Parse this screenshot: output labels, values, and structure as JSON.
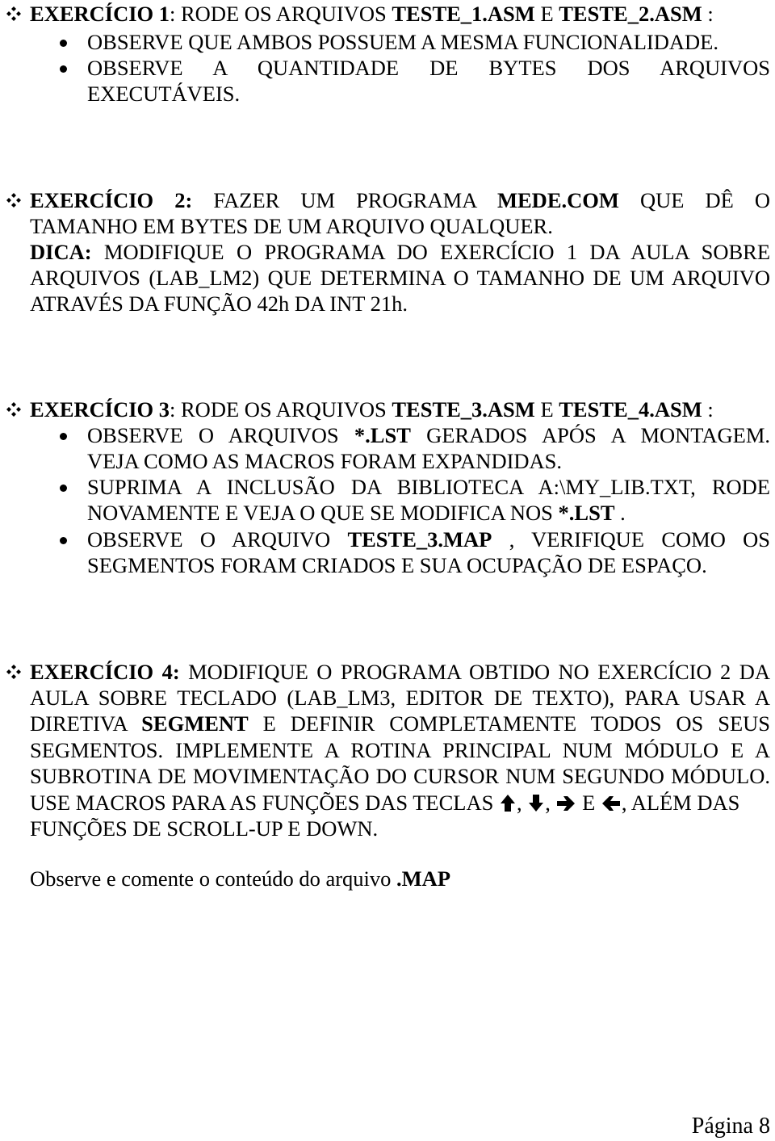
{
  "document": {
    "ex1": {
      "title": "EXERCÍCIO 1",
      "sep": ": RODE OS ARQUIVOS ",
      "file1": "TESTE_1.ASM",
      "mid": " E ",
      "file2": "TESTE_2.ASM",
      "end": " :",
      "bullets": [
        "OBSERVE QUE AMBOS POSSUEM A MESMA FUNCIONALIDADE.",
        "OBSERVE A QUANTIDADE DE BYTES DOS ARQUIVOS",
        "EXECUTÁVEIS."
      ]
    },
    "ex2": {
      "title": "EXERCÍCIO 2:",
      "l1a": "FAZER UM PROGRAMA",
      "l1b": "MEDE.COM",
      "l1c": "QUE DÊ O",
      "l2": "TAMANHO EM BYTES DE UM ARQUIVO QUALQUER.",
      "tip_label": "DICA:",
      "l3": "MODIFIQUE O PROGRAMA DO EXERCÍCIO 1 DA AULA SOBRE",
      "l4": "ARQUIVOS (LAB_LM2) QUE DETERMINA O TAMANHO DE UM ARQUIVO",
      "l5": "ATRAVÉS DA FUNÇÃO 42h DA INT 21h."
    },
    "ex3": {
      "title": "EXERCÍCIO 3",
      "sep": ": RODE OS ARQUIVOS ",
      "file1": "TESTE_3.ASM",
      "mid": " E ",
      "file2": "TESTE_4.ASM",
      "end": " :",
      "b1a": "OBSERVE O ARQUIVOS",
      "b1b": "*.LST",
      "b1c": "GERADOS APÓS A MONTAGEM.",
      "b1d": "VEJA COMO AS MACROS FORAM EXPANDIDAS.",
      "b2a": "SUPRIMA A INCLUSÃO DA BIBLIOTECA A:\\MY_LIB.TXT, RODE",
      "b2b": "NOVAMENTE E VEJA O QUE SE MODIFICA NOS ",
      "b2c": "*.LST",
      "b2d": " .",
      "b3a": "OBSERVE O ARQUIVO",
      "b3b": "TESTE_3.MAP",
      "b3c": ", VERIFIQUE COMO OS",
      "b3d": "SEGMENTOS FORAM CRIADOS E SUA OCUPAÇÃO DE ESPAÇO."
    },
    "ex4": {
      "title": "EXERCÍCIO 4:",
      "l1": "MODIFIQUE O PROGRAMA OBTIDO NO EXERCÍCIO 2 DA",
      "l2": "AULA SOBRE TECLADO (LAB_LM3, EDITOR DE TEXTO), PARA USAR A",
      "l3a": "DIRETIVA",
      "l3b": "SEGMENT",
      "l3c": "E DEFINIR COMPLETAMENTE TODOS OS SEUS",
      "l4": "SEGMENTOS. IMPLEMENTE A ROTINA PRINCIPAL NUM MÓDULO E A",
      "l5": "SUBROTINA DE MOVIMENTAÇÃO DO CURSOR NUM SEGUNDO MÓDULO.",
      "l6a": "USE MACROS PARA AS FUNÇÕES DAS TECLAS ",
      "comma": ",",
      "and": " E ",
      "l6b": ", ALÉM DAS",
      "l7": "FUNÇÕES DE SCROLL-UP E DOWN.",
      "arrows": [
        "arrow-up-icon",
        "arrow-down-icon",
        "arrow-right-icon",
        "arrow-left-icon"
      ]
    },
    "note_text": "Observe e comente o conteúdo do arquivo ",
    "note_bold": ".MAP",
    "page_label": "Página 8"
  }
}
